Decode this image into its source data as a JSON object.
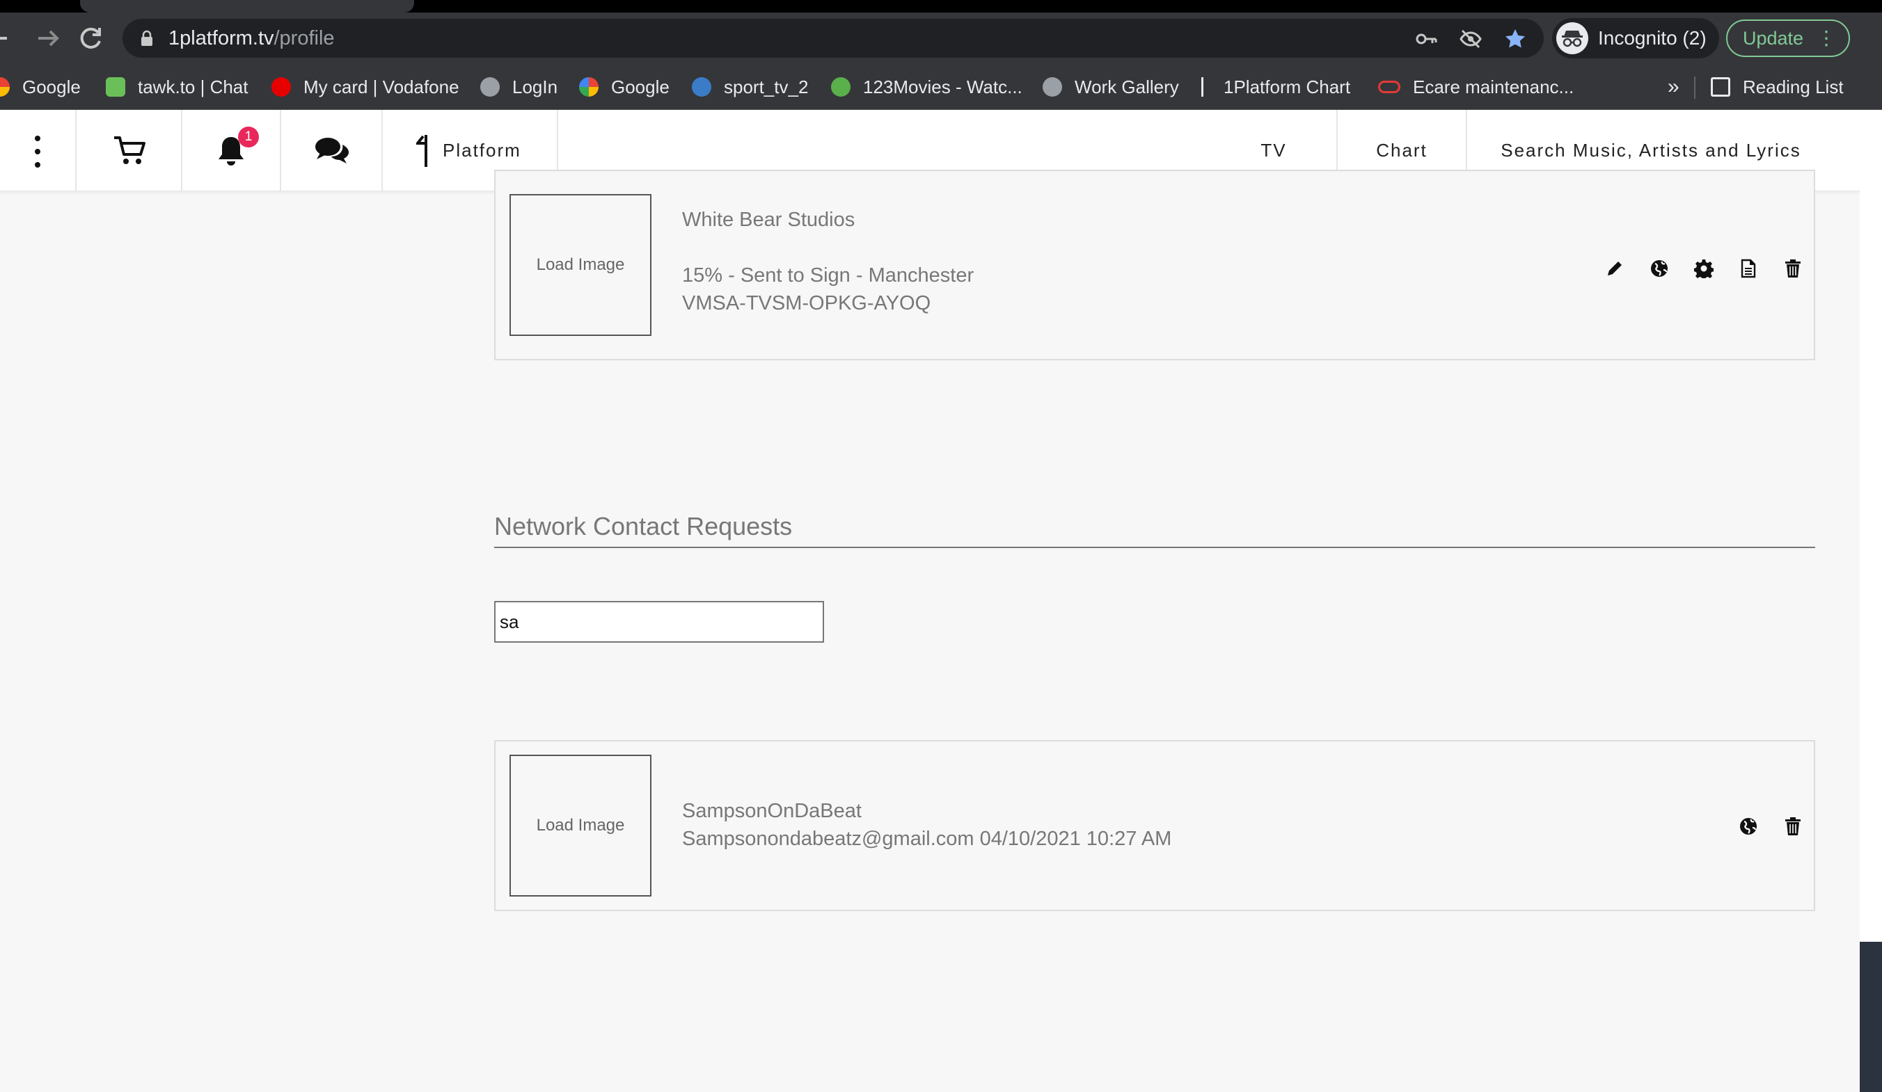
{
  "browser": {
    "url_host": "1platform.tv",
    "url_path": "/profile",
    "incognito_label": "Incognito (2)",
    "update_label": "Update",
    "bookmarks": [
      {
        "label": "Google",
        "icon": "google-icon",
        "color": "#4285f4"
      },
      {
        "label": "tawk.to | Chat",
        "icon": "tawk-icon",
        "color": "#6bbf59"
      },
      {
        "label": "My card | Vodafone",
        "icon": "vodafone-icon",
        "color": "#e60000"
      },
      {
        "label": "LogIn",
        "icon": "globe-icon",
        "color": "#9aa0a6"
      },
      {
        "label": "Google",
        "icon": "google-icon",
        "color": "#4285f4"
      },
      {
        "label": "sport_tv_2",
        "icon": "wordpress-icon",
        "color": "#3b7cc9"
      },
      {
        "label": "123Movies - Watc...",
        "icon": "play-icon",
        "color": "#5ab04a"
      },
      {
        "label": "Work Gallery",
        "icon": "globe-icon",
        "color": "#9aa0a6"
      },
      {
        "label": "1Platform Chart",
        "icon": "1platform-icon",
        "color": "#e8eaed"
      },
      {
        "label": "Ecare maintenanc...",
        "icon": "infinity-icon",
        "color": "#e53935"
      }
    ],
    "overflow_label": "»",
    "reading_list_label": "Reading List"
  },
  "header": {
    "brand_label": "Platform",
    "notification_count": "1",
    "nav": {
      "tv": "TV",
      "chart": "Chart",
      "search": "Search Music, Artists and Lyrics"
    }
  },
  "studio_card": {
    "image_label": "Load Image",
    "name": "White Bear Studios",
    "status": "15% - Sent to Sign - Manchester",
    "code": "VMSA-TVSM-OPKG-AYOQ",
    "actions": [
      "pencil-icon",
      "globe-icon",
      "gear-icon",
      "document-icon",
      "trash-icon"
    ]
  },
  "network_requests": {
    "title": "Network Contact Requests",
    "filter_value": "sa",
    "items": [
      {
        "image_label": "Load Image",
        "name": "SampsonOnDaBeat",
        "detail": "Sampsonondabeatz@gmail.com 04/10/2021 10:27 AM",
        "actions": [
          "globe-icon",
          "trash-icon"
        ]
      }
    ]
  }
}
